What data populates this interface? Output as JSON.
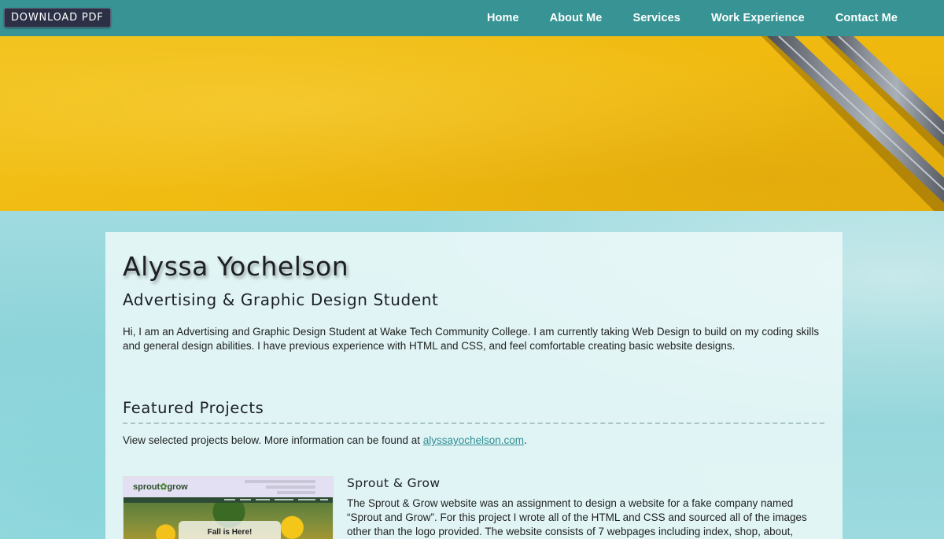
{
  "nav": {
    "pdf_button": "DOWNLOAD PDF",
    "links": [
      "Home",
      "About Me",
      "Services",
      "Work Experience",
      "Contact Me"
    ]
  },
  "profile": {
    "name": "Alyssa Yochelson",
    "title": "Advertising & Graphic Design Student",
    "intro": "Hi, I am an Advertising and Graphic Design Student at Wake Tech Community College. I am currently taking Web Design to build on my coding skills and general design abilities. I have previous experience with HTML and CSS, and feel comfortable creating basic website designs."
  },
  "featured": {
    "heading": "Featured Projects",
    "intro_text": "View selected projects below. More information can be found at ",
    "link_text": "alyssayochelson.com",
    "intro_end": "."
  },
  "project": {
    "title": "Sprout & Grow",
    "description": "The Sprout & Grow website was an assignment to design a website for a fake company named “Sprout and Grow”. For this project I wrote all of the HTML and CSS and sourced all of the images other than the logo provided. The website consists of 7 webpages including index, shop, about, resources, customer",
    "thumb_logo_left": "sprout",
    "thumb_logo_right": "grow",
    "thumb_banner": "Fall is Here!"
  },
  "colors": {
    "nav": "#389494",
    "hero": "#f2c21b",
    "page": "#8fd6db",
    "link": "#2f8f93"
  }
}
